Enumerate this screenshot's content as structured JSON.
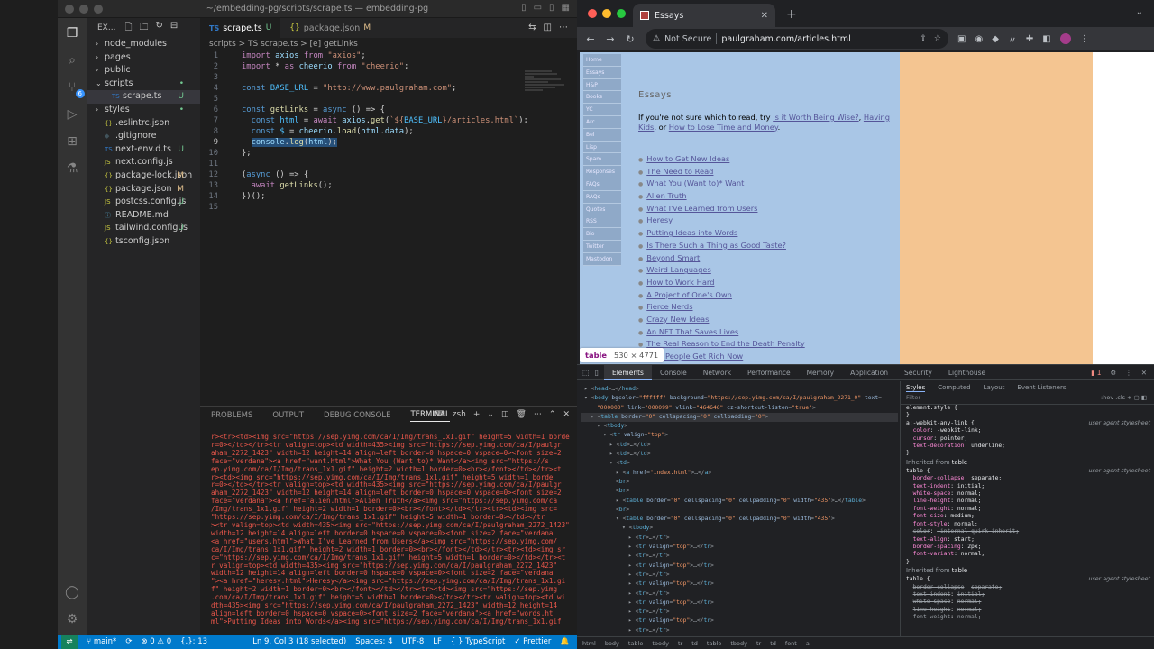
{
  "vscode": {
    "title": "~/embedding-pg/scripts/scrape.ts — embedding-pg",
    "explorer_label": "EX...",
    "files": [
      {
        "name": "node_modules",
        "type": "folder",
        "indent": 0,
        "open": false,
        "status": ""
      },
      {
        "name": "pages",
        "type": "folder",
        "indent": 0,
        "open": false,
        "status": ""
      },
      {
        "name": "public",
        "type": "folder",
        "indent": 0,
        "open": false,
        "status": ""
      },
      {
        "name": "scripts",
        "type": "folder",
        "indent": 0,
        "open": true,
        "status": "•"
      },
      {
        "name": "scrape.ts",
        "type": "ts",
        "indent": 1,
        "open": false,
        "status": "U",
        "selected": true
      },
      {
        "name": "styles",
        "type": "folder",
        "indent": 0,
        "open": false,
        "status": "•"
      },
      {
        "name": ".eslintrc.json",
        "type": "json",
        "indent": 0,
        "open": false,
        "status": ""
      },
      {
        "name": ".gitignore",
        "type": "git",
        "indent": 0,
        "open": false,
        "status": ""
      },
      {
        "name": "next-env.d.ts",
        "type": "ts",
        "indent": 0,
        "open": false,
        "status": "U"
      },
      {
        "name": "next.config.js",
        "type": "js",
        "indent": 0,
        "open": false,
        "status": ""
      },
      {
        "name": "package-lock.json",
        "type": "json",
        "indent": 0,
        "open": false,
        "status": "M"
      },
      {
        "name": "package.json",
        "type": "json",
        "indent": 0,
        "open": false,
        "status": "M"
      },
      {
        "name": "postcss.config.js",
        "type": "js",
        "indent": 0,
        "open": false,
        "status": "U"
      },
      {
        "name": "README.md",
        "type": "md",
        "indent": 0,
        "open": false,
        "status": ""
      },
      {
        "name": "tailwind.config.js",
        "type": "js",
        "indent": 0,
        "open": false,
        "status": "U"
      },
      {
        "name": "tsconfig.json",
        "type": "json",
        "indent": 0,
        "open": false,
        "status": ""
      }
    ],
    "tabs": [
      {
        "label": "scrape.ts",
        "lang": "TS",
        "status": "U",
        "active": true
      },
      {
        "label": "package.json",
        "lang": "{}",
        "status": "M",
        "active": false
      }
    ],
    "breadcrumb": "scripts > TS scrape.ts > [e] getLinks",
    "code_lines": [
      {
        "n": "1",
        "html": "<span class='kw2'>import</span> <span class='var'>axios</span> <span class='kw2'>from</span> <span class='str'>\"axios\"</span><span class='pl'>;</span>"
      },
      {
        "n": "2",
        "html": "<span class='kw2'>import</span> <span class='pl'>*</span> <span class='kw2'>as</span> <span class='var'>cheerio</span> <span class='kw2'>from</span> <span class='str'>\"cheerio\"</span><span class='pl'>;</span>"
      },
      {
        "n": "3",
        "html": ""
      },
      {
        "n": "4",
        "html": "<span class='kw'>const</span> <span class='const'>BASE_URL</span> <span class='pl'>=</span> <span class='str'>\"http://www.paulgraham.com\"</span><span class='pl'>;</span>"
      },
      {
        "n": "5",
        "html": ""
      },
      {
        "n": "6",
        "html": "<span class='kw'>const</span> <span class='fn'>getLinks</span> <span class='pl'>=</span> <span class='kw'>async</span> <span class='pl'>() =&gt; {</span>"
      },
      {
        "n": "7",
        "html": "  <span class='kw'>const</span> <span class='const'>html</span> <span class='pl'>=</span> <span class='kw2'>await</span> <span class='var'>axios</span><span class='pl'>.</span><span class='fn'>get</span><span class='pl'>(</span><span class='tmpl'>`${</span><span class='const'>BASE_URL</span><span class='tmpl'>}/articles.html`</span><span class='pl'>);</span>"
      },
      {
        "n": "8",
        "html": "  <span class='kw'>const</span> <span class='const'>$</span> <span class='pl'>=</span> <span class='var'>cheerio</span><span class='pl'>.</span><span class='fn'>load</span><span class='pl'>(</span><span class='var'>html</span><span class='pl'>.</span><span class='var'>data</span><span class='pl'>);</span>"
      },
      {
        "n": "9",
        "html": "  <span class='sel'><span class='var'>console</span><span class='pl'>.</span><span class='fn'>log</span><span class='pl'>(</span><span class='var'>html</span><span class='pl'>);</span></span>",
        "current": true
      },
      {
        "n": "10",
        "html": "<span class='pl'>};</span>"
      },
      {
        "n": "11",
        "html": ""
      },
      {
        "n": "12",
        "html": "<span class='pl'>(</span><span class='kw'>async</span> <span class='pl'>() =&gt; {</span>"
      },
      {
        "n": "13",
        "html": "  <span class='kw2'>await</span> <span class='fn'>getLinks</span><span class='pl'>();</span>"
      },
      {
        "n": "14",
        "html": "<span class='pl'>})();</span>"
      },
      {
        "n": "15",
        "html": ""
      }
    ],
    "panel_tabs": [
      "PROBLEMS",
      "OUTPUT",
      "DEBUG CONSOLE",
      "TERMINAL"
    ],
    "panel_active": "TERMINAL",
    "terminal_shell": "zsh",
    "terminal_lines": [
      "r><tr><td><img src=\"https://sep.yimg.com/ca/I/Img/trans_1x1.gif\" height=5 width=1 borde",
      "r=0></td></tr><tr valign=top><td width=435><img src=\"https://sep.yimg.com/ca/I/paulgr",
      "aham_2272_1423\" width=12 height=14 align=left border=0 hspace=0 vspace=0><font size=2",
      "face=\"verdana\"><a href=\"want.html\">What You (Want to)* Want</a><img src=\"https://s",
      "ep.yimg.com/ca/I/Img/trans_1x1.gif\" height=2 width=1 border=0><br></font></td></tr><t",
      "r><td><img src=\"https://sep.yimg.com/ca/I/Img/trans_1x1.gif\" height=5 width=1 borde",
      "r=0></td></tr><tr valign=top><td width=435><img src=\"https://sep.yimg.com/ca/I/paulgr",
      "aham_2272_1423\" width=12 height=14 align=left border=0 hspace=0 vspace=0><font size=2",
      "face=\"verdana\"><a href=\"alien.html\">Alien Truth</a><img src=\"https://sep.yimg.com/ca",
      "/Img/trans_1x1.gif\" height=2 width=1 border=0><br></font></td></tr><tr><td><img src=",
      "\"https://sep.yimg.com/ca/I/Img/trans_1x1.gif\" height=5 width=1 border=0></td></tr",
      "><tr valign=top><td width=435><img src=\"https://sep.yimg.com/ca/I/paulgraham_2272_1423\"",
      "width=12 height=14 align=left border=0 hspace=0 vspace=0><font size=2 face=\"verdana",
      "<a href=\"users.html\">What I've Learned from Users</a><img src=\"https://sep.yimg.com/",
      "ca/I/Img/trans_1x1.gif\" height=2 width=1 border=0><br></font></td></tr><tr><td><img sr",
      "c=\"https://sep.yimg.com/ca/I/Img/trans_1x1.gif\" height=5 width=1 border=0></td></tr><t",
      "r valign=top><td width=435><img src=\"https://sep.yimg.com/ca/I/paulgraham_2272_1423\"",
      "width=12 height=14 align=left border=0 hspace=0 vspace=0><font size=2 face=\"verdana",
      "\"><a href=\"heresy.html\">Heresy</a><img src=\"https://sep.yimg.com/ca/I/Img/trans_1x1.gi",
      "f\" height=2 width=1 border=0><br></font></td></tr><tr><td><img src=\"https://sep.yimg",
      ".com/ca/I/Img/trans_1x1.gif\" height=5 width=1 border=0></td></tr><tr valign=top><td wi",
      "dth=435><img src=\"https://sep.yimg.com/ca/I/paulgraham_2272_1423\" width=12 height=14",
      " align=left border=0 hspace=0 vspace=0><font size=2 face=\"verdana\"><a href=\"words.ht",
      "ml\">Putting Ideas into Words</a><img src=\"https://sep.yimg.com/ca/I/Img/trans_1x1.gif"
    ],
    "status": {
      "branch": "main*",
      "sync": "⟳",
      "problems": "⊗ 0 ⚠ 0",
      "quokka": "{.}: 13",
      "position": "Ln 9, Col 3 (18 selected)",
      "spaces": "Spaces: 4",
      "encoding": "UTF-8",
      "eol": "LF",
      "language": "{ } TypeScript",
      "prettier": "✓ Prettier"
    }
  },
  "chrome": {
    "tab_title": "Essays",
    "security": "Not Secure",
    "url_host": "paulgraham.com",
    "url_path": "/articles.html",
    "page": {
      "nav": [
        "Home",
        "Essays",
        "H&P",
        "Books",
        "YC",
        "Arc",
        "Bel",
        "Lisp",
        "Spam",
        "Responses",
        "FAQs",
        "RAQs",
        "Quotes",
        "RSS",
        "Bio",
        "Twitter",
        "Mastodon"
      ],
      "title": "Essays",
      "intro_prefix": "If you're not sure which to read, try ",
      "intro_link1": "Is it Worth Being Wise?",
      "intro_sep": ", ",
      "intro_link2": "Having Kids",
      "intro_mid": ", or ",
      "intro_link3": "How to Lose Time and Money",
      "intro_end": ".",
      "essays": [
        "How to Get New Ideas",
        "The Need to Read",
        "What You (Want to)* Want",
        "Alien Truth",
        "What I've Learned from Users",
        "Heresy",
        "Putting Ideas into Words",
        "Is There Such a Thing as Good Taste?",
        "Beyond Smart",
        "Weird Languages",
        "How to Work Hard",
        "A Project of One's Own",
        "Fierce Nerds",
        "Crazy New Ideas",
        "An NFT That Saves Lives",
        "The Real Reason to End the Death Penalty",
        "How People Get Rich Now"
      ],
      "tooltip_tag": "table",
      "tooltip_dims": "530 × 4771"
    },
    "devtools": {
      "tabs": [
        "Elements",
        "Console",
        "Network",
        "Performance",
        "Memory",
        "Application",
        "Security",
        "Lighthouse"
      ],
      "active_tab": "Elements",
      "issues": "1",
      "dom_lines": [
        {
          "indent": 0,
          "html": "▸ &lt;<span class='tg'>head</span>&gt;…&lt;/<span class='tg'>head</span>&gt;"
        },
        {
          "indent": 0,
          "html": "▾ &lt;<span class='tg'>body</span> <span class='an'>bgcolor</span>=<span class='av'>\"ffffff\"</span> <span class='an'>background</span>=<span class='av'>\"https://sep.yimg.com/ca/I/paulgraham_2271_0\"</span> <span class='an'>text</span>="
        },
        {
          "indent": 2,
          "html": "<span class='av'>\"000000\"</span> <span class='an'>link</span>=<span class='av'>\"000099\"</span> <span class='an'>vlink</span>=<span class='av'>\"464646\"</span> <span class='an'>cz-shortcut-listen</span>=<span class='av'>\"true\"</span>&gt;"
        },
        {
          "indent": 1,
          "html": "▾ &lt;<span class='tg'>table</span> <span class='an'>border</span>=<span class='av'>\"0\"</span> <span class='an'>cellspacing</span>=<span class='av'>\"0\"</span> <span class='an'>cellpadding</span>=<span class='av'>\"0\"</span>&gt;",
          "hl": true
        },
        {
          "indent": 2,
          "html": "▾ &lt;<span class='tg'>tbody</span>&gt;"
        },
        {
          "indent": 3,
          "html": "▾ &lt;<span class='tg'>tr</span> <span class='an'>valign</span>=<span class='av'>\"top\"</span>&gt;"
        },
        {
          "indent": 4,
          "html": "▸ &lt;<span class='tg'>td</span>&gt;…&lt;/<span class='tg'>td</span>&gt;"
        },
        {
          "indent": 4,
          "html": "▸ &lt;<span class='tg'>td</span>&gt;…&lt;/<span class='tg'>td</span>&gt;"
        },
        {
          "indent": 4,
          "html": "▾ &lt;<span class='tg'>td</span>&gt;"
        },
        {
          "indent": 5,
          "html": "▸ &lt;<span class='tg'>a</span> <span class='an'>href</span>=<span class='av'>\"index.html\"</span>&gt;…&lt;/<span class='tg'>a</span>&gt;"
        },
        {
          "indent": 5,
          "html": "&lt;<span class='tg'>br</span>&gt;"
        },
        {
          "indent": 5,
          "html": "&lt;<span class='tg'>br</span>&gt;"
        },
        {
          "indent": 5,
          "html": "▸ &lt;<span class='tg'>table</span> <span class='an'>border</span>=<span class='av'>\"0\"</span> <span class='an'>cellspacing</span>=<span class='av'>\"0\"</span> <span class='an'>cellpadding</span>=<span class='av'>\"0\"</span> <span class='an'>width</span>=<span class='av'>\"435\"</span>&gt;…&lt;/<span class='tg'>table</span>&gt;"
        },
        {
          "indent": 5,
          "html": "&lt;<span class='tg'>br</span>&gt;"
        },
        {
          "indent": 5,
          "html": "▾ &lt;<span class='tg'>table</span> <span class='an'>border</span>=<span class='av'>\"0\"</span> <span class='an'>cellspacing</span>=<span class='av'>\"0\"</span> <span class='an'>cellpadding</span>=<span class='av'>\"0\"</span> <span class='an'>width</span>=<span class='av'>\"435\"</span>&gt;"
        },
        {
          "indent": 6,
          "html": "▾ &lt;<span class='tg'>tbody</span>&gt;"
        },
        {
          "indent": 7,
          "html": "▸ &lt;<span class='tg'>tr</span>&gt;…&lt;/<span class='tg'>tr</span>&gt;"
        },
        {
          "indent": 7,
          "html": "▸ &lt;<span class='tg'>tr</span> <span class='an'>valign</span>=<span class='av'>\"top\"</span>&gt;…&lt;/<span class='tg'>tr</span>&gt;"
        },
        {
          "indent": 7,
          "html": "▸ &lt;<span class='tg'>tr</span>&gt;…&lt;/<span class='tg'>tr</span>&gt;"
        },
        {
          "indent": 7,
          "html": "▸ &lt;<span class='tg'>tr</span> <span class='an'>valign</span>=<span class='av'>\"top\"</span>&gt;…&lt;/<span class='tg'>tr</span>&gt;"
        },
        {
          "indent": 7,
          "html": "▸ &lt;<span class='tg'>tr</span>&gt;…&lt;/<span class='tg'>tr</span>&gt;"
        },
        {
          "indent": 7,
          "html": "▸ &lt;<span class='tg'>tr</span> <span class='an'>valign</span>=<span class='av'>\"top\"</span>&gt;…&lt;/<span class='tg'>tr</span>&gt;"
        },
        {
          "indent": 7,
          "html": "▸ &lt;<span class='tg'>tr</span>&gt;…&lt;/<span class='tg'>tr</span>&gt;"
        },
        {
          "indent": 7,
          "html": "▸ &lt;<span class='tg'>tr</span> <span class='an'>valign</span>=<span class='av'>\"top\"</span>&gt;…&lt;/<span class='tg'>tr</span>&gt;"
        },
        {
          "indent": 7,
          "html": "▸ &lt;<span class='tg'>tr</span>&gt;…&lt;/<span class='tg'>tr</span>&gt;"
        },
        {
          "indent": 7,
          "html": "▸ &lt;<span class='tg'>tr</span> <span class='an'>valign</span>=<span class='av'>\"top\"</span>&gt;…&lt;/<span class='tg'>tr</span>&gt;"
        },
        {
          "indent": 7,
          "html": "▸ &lt;<span class='tg'>tr</span>&gt;…&lt;/<span class='tg'>tr</span>&gt;"
        },
        {
          "indent": 7,
          "html": "▸ &lt;<span class='tg'>tr</span> <span class='an'>valign</span>=<span class='av'>\"top\"</span>&gt;…&lt;/<span class='tg'>tr</span>&gt;"
        }
      ],
      "styles_tabs": [
        "Styles",
        "Computed",
        "Layout",
        "Event Listeners"
      ],
      "filter_placeholder": "Filter",
      "filter_right": ":hov .cls + ▢ ◧",
      "styles": [
        {
          "kind": "line",
          "html": "<span class='sel2'>element.style {</span>"
        },
        {
          "kind": "line",
          "html": "}"
        },
        {
          "kind": "line",
          "html": "<span class='sel2'>a:-webkit-any-link {</span>",
          "src": "user agent stylesheet"
        },
        {
          "kind": "line",
          "html": "&nbsp;&nbsp;<span class='prop'>color</span>: <span class='val'>-webkit-link;</span>"
        },
        {
          "kind": "line",
          "html": "&nbsp;&nbsp;<span class='prop'>cursor</span>: <span class='val'>pointer;</span>"
        },
        {
          "kind": "line",
          "html": "&nbsp;&nbsp;<span class='prop'>text-decoration</span>: <span class='val'>underline;</span>"
        },
        {
          "kind": "line",
          "html": "}"
        },
        {
          "kind": "head",
          "label": "Inherited from",
          "tag": "table"
        },
        {
          "kind": "line",
          "html": "<span class='sel2'>table {</span>",
          "src": "user agent stylesheet"
        },
        {
          "kind": "line",
          "html": "&nbsp;&nbsp;<span class='prop'>border-collapse</span>: <span class='val'>separate;</span>"
        },
        {
          "kind": "line",
          "html": "&nbsp;&nbsp;<span class='prop'>text-indent</span>: <span class='val'>initial;</span>"
        },
        {
          "kind": "line",
          "html": "&nbsp;&nbsp;<span class='prop'>white-space</span>: <span class='val'>normal;</span>"
        },
        {
          "kind": "line",
          "html": "&nbsp;&nbsp;<span class='prop'>line-height</span>: <span class='val'>normal;</span>"
        },
        {
          "kind": "line",
          "html": "&nbsp;&nbsp;<span class='prop'>font-weight</span>: <span class='val'>normal;</span>"
        },
        {
          "kind": "line",
          "html": "&nbsp;&nbsp;<span class='prop'>font-size</span>: <span class='val'>medium;</span>"
        },
        {
          "kind": "line",
          "html": "&nbsp;&nbsp;<span class='prop'>font-style</span>: <span class='val'>normal;</span>"
        },
        {
          "kind": "line",
          "strike": true,
          "html": "&nbsp;&nbsp;<span class='prop'>color</span>: <span class='val'>-internal-quirk-inherit;</span>"
        },
        {
          "kind": "line",
          "html": "&nbsp;&nbsp;<span class='prop'>text-align</span>: <span class='val'>start;</span>"
        },
        {
          "kind": "line",
          "html": "&nbsp;&nbsp;<span class='prop'>border-spacing</span>: <span class='val'>2px;</span>"
        },
        {
          "kind": "line",
          "html": "&nbsp;&nbsp;<span class='prop'>font-variant</span>: <span class='val'>normal;</span>"
        },
        {
          "kind": "line",
          "html": "}"
        },
        {
          "kind": "head",
          "label": "Inherited from",
          "tag": "table"
        },
        {
          "kind": "line",
          "html": "<span class='sel2'>table {</span>",
          "src": "user agent stylesheet"
        },
        {
          "kind": "line",
          "strike": true,
          "html": "&nbsp;&nbsp;<span class='prop'>border-collapse</span>: <span class='val'>separate;</span>"
        },
        {
          "kind": "line",
          "strike": true,
          "html": "&nbsp;&nbsp;<span class='prop'>text-indent</span>: <span class='val'>initial;</span>"
        },
        {
          "kind": "line",
          "strike": true,
          "html": "&nbsp;&nbsp;<span class='prop'>white-space</span>: <span class='val'>normal;</span>"
        },
        {
          "kind": "line",
          "strike": true,
          "html": "&nbsp;&nbsp;<span class='prop'>line-height</span>: <span class='val'>normal;</span>"
        },
        {
          "kind": "line",
          "strike": true,
          "html": "&nbsp;&nbsp;<span class='prop'>font-weight</span>: <span class='val'>normal;</span>"
        }
      ],
      "breadcrumbs": [
        "html",
        "body",
        "table",
        "tbody",
        "tr",
        "td",
        "table",
        "tbody",
        "tr",
        "td",
        "font",
        "a"
      ]
    }
  }
}
